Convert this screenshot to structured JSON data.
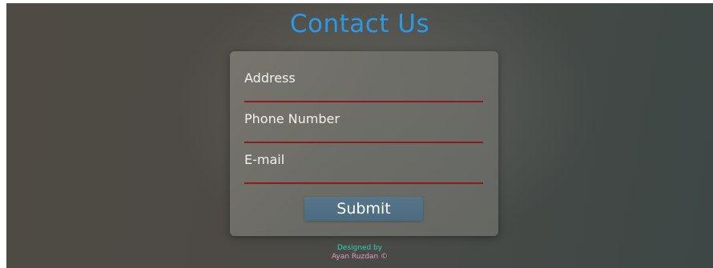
{
  "header": {
    "title": "Contact Us"
  },
  "form": {
    "fields": [
      {
        "label": "Address",
        "value": ""
      },
      {
        "label": "Phone Number",
        "value": ""
      },
      {
        "label": "E-mail",
        "value": ""
      }
    ],
    "submit_label": "Submit"
  },
  "footer": {
    "line1": "Designed by",
    "line2": "Ayan Ruzdan ©"
  },
  "colors": {
    "title": "#2b9ae6",
    "underline": "#8e1a1a",
    "submit_bg": "#52708a",
    "footer_line1": "#2fd2b4",
    "footer_line2": "#e29bc6"
  }
}
